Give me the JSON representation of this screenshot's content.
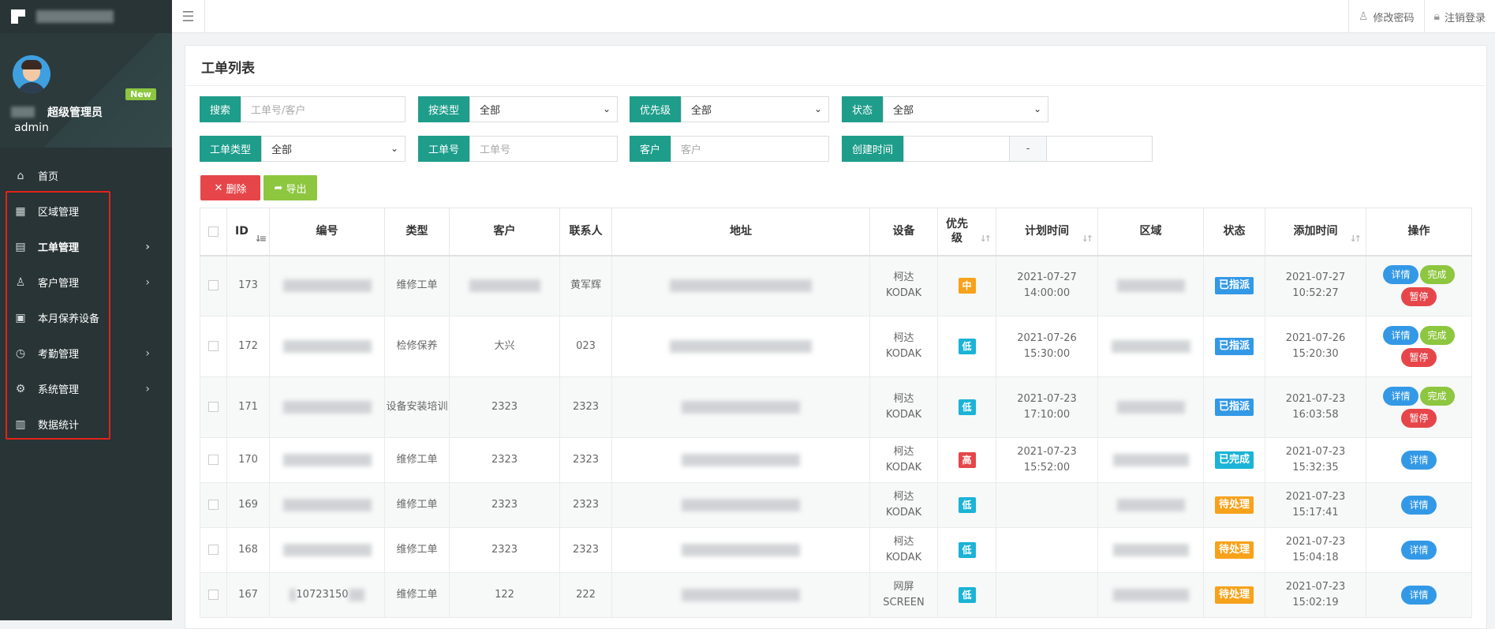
{
  "sidebar": {
    "user": {
      "role": "超级管理员",
      "login": "admin",
      "badge": "New"
    },
    "items": [
      {
        "label": "首页",
        "icon": "home-icon",
        "arrow": false
      },
      {
        "label": "区域管理",
        "icon": "grid-icon",
        "arrow": false
      },
      {
        "label": "工单管理",
        "icon": "list-icon",
        "arrow": true,
        "active": true
      },
      {
        "label": "客户管理",
        "icon": "user-icon",
        "arrow": true
      },
      {
        "label": "本月保养设备",
        "icon": "device-icon",
        "arrow": false
      },
      {
        "label": "考勤管理",
        "icon": "clock-icon",
        "arrow": true
      },
      {
        "label": "系统管理",
        "icon": "gear-icon",
        "arrow": true
      },
      {
        "label": "数据统计",
        "icon": "bar-chart-icon",
        "arrow": false
      }
    ]
  },
  "topbar": {
    "change_password": "修改密码",
    "logout": "注销登录"
  },
  "page": {
    "title": "工单列表"
  },
  "filters": {
    "search_label": "搜索",
    "search_placeholder": "工单号/客户",
    "by_type_label": "按类型",
    "by_type_value": "全部",
    "priority_label": "优先级",
    "priority_value": "全部",
    "status_label": "状态",
    "status_value": "全部",
    "order_type_label": "工单类型",
    "order_type_value": "全部",
    "order_no_label": "工单号",
    "order_no_placeholder": "工单号",
    "customer_label": "客户",
    "customer_placeholder": "客户",
    "created_label": "创建时间",
    "range_sep": "-"
  },
  "actions": {
    "delete": "删除",
    "export": "导出"
  },
  "table": {
    "headers": {
      "id": "ID",
      "no": "编号",
      "type": "类型",
      "customer": "客户",
      "contact": "联系人",
      "address": "地址",
      "device": "设备",
      "priority_1": "优先",
      "priority_2": "级",
      "planned": "计划时间",
      "region": "区域",
      "status": "状态",
      "added": "添加时间",
      "ops": "操作"
    },
    "rows": [
      {
        "id": "173",
        "no": "",
        "type": "维修工单",
        "customer": "",
        "contact": "黄军辉",
        "device_1": "柯达",
        "device_2": "KODAK",
        "priority": "中",
        "prio_color": "#f7a21b",
        "planned_date": "2021-07-27",
        "planned_time": "14:00:00",
        "status": "已指派",
        "status_color": "#3399e6",
        "added_date": "2021-07-27",
        "added_time": "10:52:27",
        "ops": [
          "详情",
          "完成",
          "暂停"
        ]
      },
      {
        "id": "172",
        "no": "",
        "type": "检修保养",
        "customer": "大兴",
        "contact": "023",
        "device_1": "柯达",
        "device_2": "KODAK",
        "priority": "低",
        "prio_color": "#1bb3d6",
        "planned_date": "2021-07-26",
        "planned_time": "15:30:00",
        "status": "已指派",
        "status_color": "#3399e6",
        "added_date": "2021-07-26",
        "added_time": "15:20:30",
        "ops": [
          "详情",
          "完成",
          "暂停"
        ]
      },
      {
        "id": "171",
        "no": "",
        "type": "设备安装培训",
        "customer": "2323",
        "contact": "2323",
        "device_1": "柯达",
        "device_2": "KODAK",
        "priority": "低",
        "prio_color": "#1bb3d6",
        "planned_date": "2021-07-23",
        "planned_time": "17:10:00",
        "status": "已指派",
        "status_color": "#3399e6",
        "added_date": "2021-07-23",
        "added_time": "16:03:58",
        "ops": [
          "详情",
          "完成",
          "暂停"
        ]
      },
      {
        "id": "170",
        "no": "",
        "type": "维修工单",
        "customer": "2323",
        "contact": "2323",
        "device_1": "柯达",
        "device_2": "KODAK",
        "priority": "高",
        "prio_color": "#e6464a",
        "planned_date": "2021-07-23",
        "planned_time": "15:52:00",
        "status": "已完成",
        "status_color": "#1bb3d6",
        "added_date": "2021-07-23",
        "added_time": "15:32:35",
        "ops": [
          "详情"
        ]
      },
      {
        "id": "169",
        "no": "",
        "type": "维修工单",
        "customer": "2323",
        "contact": "2323",
        "device_1": "柯达",
        "device_2": "KODAK",
        "priority": "低",
        "prio_color": "#1bb3d6",
        "planned_date": "",
        "planned_time": "",
        "status": "待处理",
        "status_color": "#f7a21b",
        "added_date": "2021-07-23",
        "added_time": "15:17:41",
        "ops": [
          "详情"
        ]
      },
      {
        "id": "168",
        "no": "",
        "type": "维修工单",
        "customer": "2323",
        "contact": "2323",
        "device_1": "柯达",
        "device_2": "KODAK",
        "priority": "低",
        "prio_color": "#1bb3d6",
        "planned_date": "",
        "planned_time": "",
        "status": "待处理",
        "status_color": "#f7a21b",
        "added_date": "2021-07-23",
        "added_time": "15:04:18",
        "ops": [
          "详情"
        ]
      },
      {
        "id": "167",
        "no": "10723150",
        "type": "维修工单",
        "customer": "122",
        "contact": "222",
        "device_1": "网屏",
        "device_2": "SCREEN",
        "priority": "低",
        "prio_color": "#1bb3d6",
        "planned_date": "",
        "planned_time": "",
        "status": "待处理",
        "status_color": "#f7a21b",
        "added_date": "2021-07-23",
        "added_time": "15:02:19",
        "ops": [
          "详情"
        ]
      }
    ]
  }
}
